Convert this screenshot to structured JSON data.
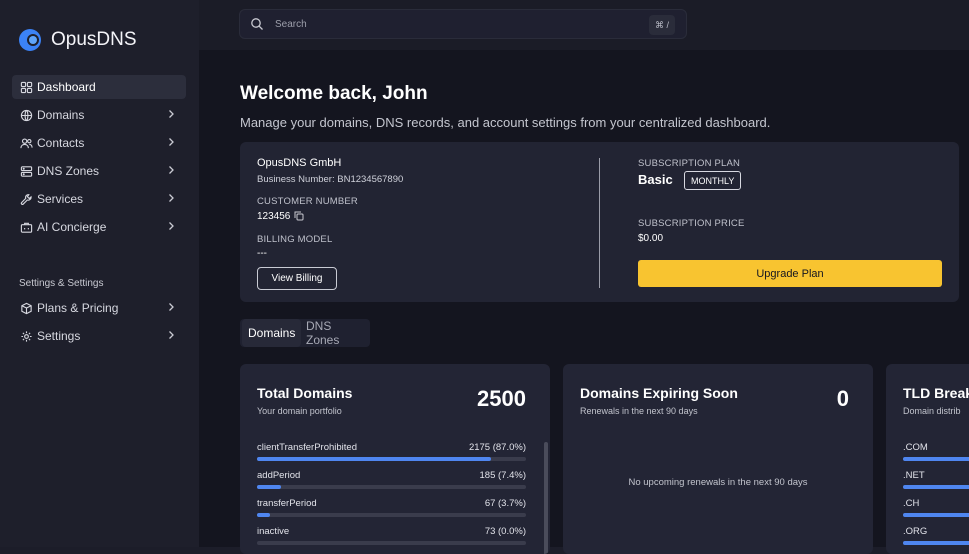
{
  "brand": {
    "name": "OpusDNS",
    "accent": "#3b82f6",
    "upgrade_color": "#f8c430"
  },
  "sidebar": {
    "items": [
      {
        "label": "Dashboard",
        "icon": "dashboard-icon",
        "active": true
      },
      {
        "label": "Domains",
        "icon": "globe-icon"
      },
      {
        "label": "Contacts",
        "icon": "users-icon"
      },
      {
        "label": "DNS Zones",
        "icon": "server-icon"
      },
      {
        "label": "Services",
        "icon": "wrench-icon"
      },
      {
        "label": "AI Concierge",
        "icon": "briefcase-icon"
      }
    ],
    "section_title": "Settings & Settings",
    "settings_items": [
      {
        "label": "Plans & Pricing",
        "icon": "box-icon"
      },
      {
        "label": "Settings",
        "icon": "gear-icon"
      }
    ]
  },
  "search": {
    "placeholder": "Search",
    "shortcut": "⌘ /"
  },
  "header": {
    "title": "Welcome back, John",
    "subtitle": "Manage your domains, DNS records, and account settings from your centralized dashboard."
  },
  "account": {
    "company": "OpusDNS GmbH",
    "business_number": "Business Number: BN1234567890",
    "customer_number_label": "CUSTOMER NUMBER",
    "customer_number": "123456",
    "billing_model_label": "BILLING MODEL",
    "billing_model": "---",
    "view_billing": "View Billing",
    "plan_label": "SUBSCRIPTION PLAN",
    "plan": "Basic",
    "plan_cycle": "MONTHLY",
    "price_label": "SUBSCRIPTION PRICE",
    "price": "$0.00",
    "upgrade": "Upgrade Plan"
  },
  "tabs": [
    {
      "label": "Domains",
      "active": true
    },
    {
      "label": "DNS Zones",
      "active": false
    }
  ],
  "total_domains": {
    "title": "Total Domains",
    "subtitle": "Your domain portfolio",
    "count": "2500",
    "statuses": [
      {
        "label": "clientTransferProhibited",
        "value": "2175 (87.0%)",
        "fraction": 0.87
      },
      {
        "label": "addPeriod",
        "value": "185 (7.4%)",
        "fraction": 0.09
      },
      {
        "label": "transferPeriod",
        "value": "67 (3.7%)",
        "fraction": 0.05
      },
      {
        "label": "inactive",
        "value": "73 (0.0%)",
        "fraction": 0.0
      }
    ]
  },
  "expiring": {
    "title": "Domains Expiring Soon",
    "subtitle": "Renewals in the next 90 days",
    "count": "0",
    "empty": "No upcoming renewals in the next 90 days"
  },
  "tld": {
    "title": "TLD Break",
    "subtitle": "Domain distrib",
    "items": [
      ".COM",
      ".NET",
      ".CH",
      ".ORG"
    ]
  }
}
